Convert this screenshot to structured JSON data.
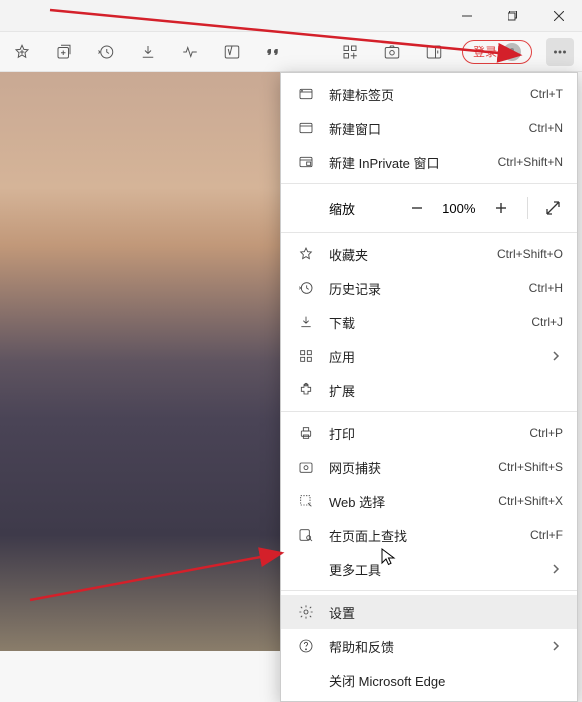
{
  "login": {
    "label": "登录"
  },
  "menu": {
    "new_tab": {
      "label": "新建标签页",
      "shortcut": "Ctrl+T"
    },
    "new_window": {
      "label": "新建窗口",
      "shortcut": "Ctrl+N"
    },
    "new_inprivate": {
      "label": "新建 InPrivate 窗口",
      "shortcut": "Ctrl+Shift+N"
    },
    "zoom": {
      "label": "缩放",
      "value": "100%"
    },
    "favorites": {
      "label": "收藏夹",
      "shortcut": "Ctrl+Shift+O"
    },
    "history": {
      "label": "历史记录",
      "shortcut": "Ctrl+H"
    },
    "downloads": {
      "label": "下载",
      "shortcut": "Ctrl+J"
    },
    "apps": {
      "label": "应用"
    },
    "extensions": {
      "label": "扩展"
    },
    "print": {
      "label": "打印",
      "shortcut": "Ctrl+P"
    },
    "web_capture": {
      "label": "网页捕获",
      "shortcut": "Ctrl+Shift+S"
    },
    "web_select": {
      "label": "Web 选择",
      "shortcut": "Ctrl+Shift+X"
    },
    "find": {
      "label": "在页面上查找",
      "shortcut": "Ctrl+F"
    },
    "more_tools": {
      "label": "更多工具"
    },
    "settings": {
      "label": "设置"
    },
    "help": {
      "label": "帮助和反馈"
    },
    "close": {
      "label": "关闭 Microsoft Edge"
    }
  },
  "annotation": {
    "arrow_color": "#d4202a"
  }
}
